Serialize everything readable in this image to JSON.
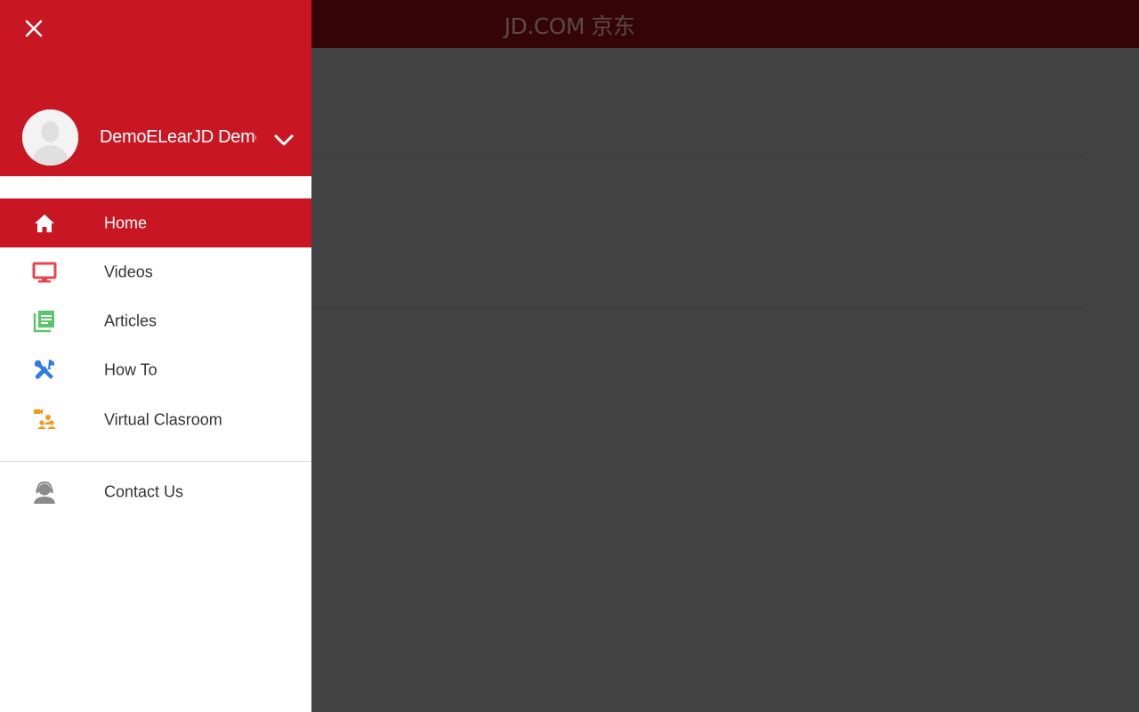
{
  "app": {
    "logo_text": "JD.COM 京东"
  },
  "drawer": {
    "user": {
      "name": "DemoELearJD Demo"
    },
    "menu": [
      {
        "label": "Home",
        "icon": "home-icon",
        "active": true,
        "color": "#ffffff"
      },
      {
        "label": "Videos",
        "icon": "monitor-icon",
        "active": false,
        "color": "#e8434f"
      },
      {
        "label": "Articles",
        "icon": "articles-icon",
        "active": false,
        "color": "#5cc46a"
      },
      {
        "label": "How To",
        "icon": "tools-icon",
        "active": false,
        "color": "#2f7de1"
      },
      {
        "label": "Virtual Clasroom",
        "icon": "virtual-classroom-icon",
        "active": false,
        "color": "#f39a1e"
      }
    ],
    "footer_menu": [
      {
        "label": "Contact Us",
        "icon": "support-agent-icon",
        "active": false,
        "color": "#8a8a8a"
      }
    ]
  },
  "colors": {
    "brand_red": "#c81623",
    "scrim": "#424242",
    "header_dimmed": "#350407"
  }
}
